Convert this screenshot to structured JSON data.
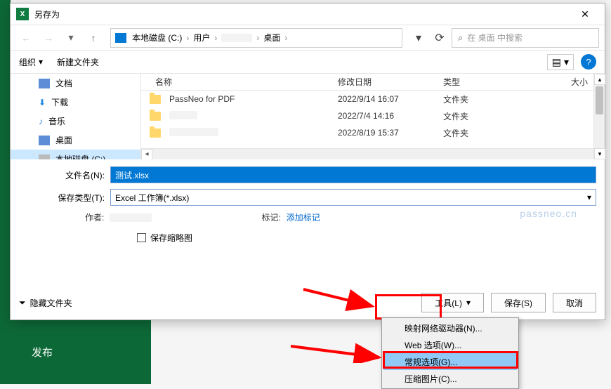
{
  "dialog": {
    "title": "另存为",
    "close_icon": "✕"
  },
  "nav": {
    "back_icon": "←",
    "fwd_icon": "→",
    "up_icon": "↑",
    "refresh_icon": "⟳",
    "drop_icon": "▾"
  },
  "breadcrumb": {
    "root": "本地磁盘 (C:)",
    "p1": "用户",
    "p3": "桌面",
    "sep": "›"
  },
  "search": {
    "placeholder": "在 桌面 中搜索",
    "icon": "⌕"
  },
  "toolbar": {
    "organize": "组织",
    "new_folder": "新建文件夹",
    "view_icon": "▤",
    "help_icon": "?"
  },
  "sidebar": {
    "items": [
      {
        "label": "文档",
        "color": "#1e88e5"
      },
      {
        "label": "下载",
        "color": "#1e88e5"
      },
      {
        "label": "音乐",
        "color": "#1e88e5"
      },
      {
        "label": "桌面",
        "color": "#5c8dd6"
      },
      {
        "label": "本地磁盘 (C:)",
        "color": "#888"
      }
    ]
  },
  "columns": {
    "name": "名称",
    "date": "修改日期",
    "type": "类型",
    "size": "大小"
  },
  "files": [
    {
      "name": "PassNeo for PDF",
      "date": "2022/9/14 16:07",
      "type": "文件夹"
    },
    {
      "name": "",
      "date": "2022/7/4 14:16",
      "type": "文件夹"
    },
    {
      "name": "",
      "date": "2022/8/19 15:37",
      "type": "文件夹"
    }
  ],
  "form": {
    "filename_label": "文件名(N):",
    "filename_value": "测试.xlsx",
    "filetype_label": "保存类型(T):",
    "filetype_value": "Excel 工作簿(*.xlsx)",
    "author_label": "作者:",
    "tags_label": "标记:",
    "tags_link": "添加标记",
    "thumb_label": "保存缩略图"
  },
  "footer": {
    "hide_folders": "隐藏文件夹",
    "tools": "工具(L)",
    "save": "保存(S)",
    "cancel": "取消",
    "caret": "▾",
    "caret_left": "⏷"
  },
  "menu": {
    "items": [
      "映射网络驱动器(N)...",
      "Web 选项(W)...",
      "常规选项(G)...",
      "压缩图片(C)..."
    ]
  },
  "bg": {
    "publish": "发布"
  },
  "watermark": "passneo.cn"
}
